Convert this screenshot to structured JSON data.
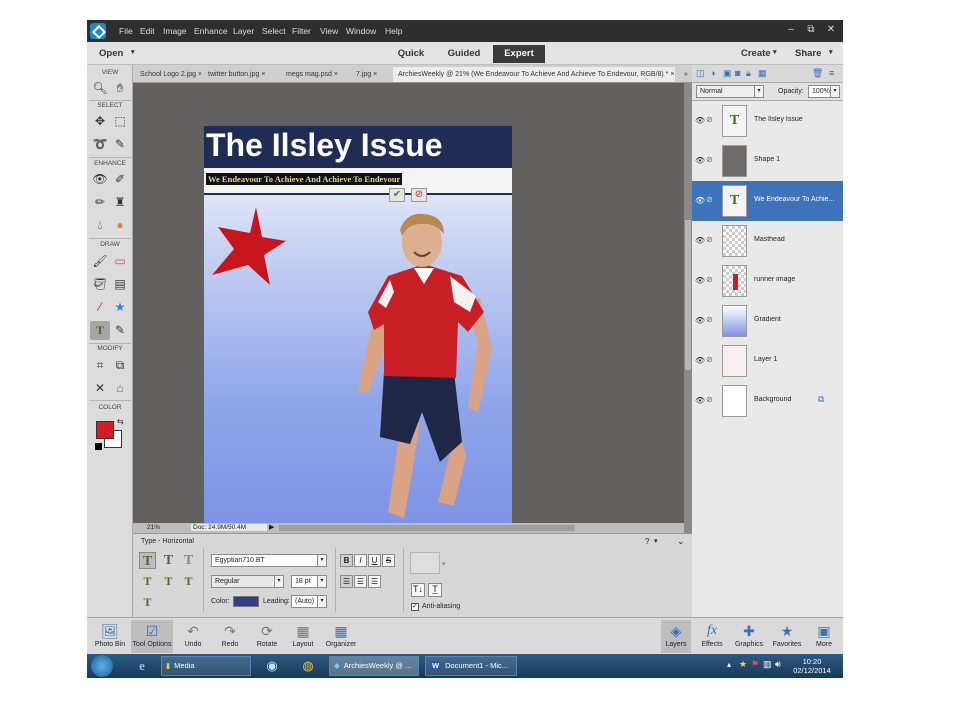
{
  "menu": [
    "File",
    "Edit",
    "Image",
    "Enhance",
    "Layer",
    "Select",
    "Filter",
    "View",
    "Window",
    "Help"
  ],
  "window_controls": [
    "–",
    "⧉",
    "✕"
  ],
  "modebar": {
    "open_label": "Open",
    "modes": [
      "Quick",
      "Guided",
      "Expert"
    ],
    "active_mode": "Expert",
    "create_label": "Create",
    "share_label": "Share"
  },
  "toolbar": {
    "sections": [
      "VIEW",
      "SELECT",
      "ENHANCE",
      "DRAW",
      "MODIFY",
      "COLOR"
    ],
    "tools": [
      {
        "name": "zoom-tool-icon",
        "glyph": "🔍︎"
      },
      {
        "name": "hand-tool-icon",
        "glyph": "✋︎"
      },
      {
        "name": "move-tool-icon",
        "glyph": "✥"
      },
      {
        "name": "marquee-tool-icon",
        "glyph": "⬚"
      },
      {
        "name": "lasso-tool-icon",
        "glyph": "➰"
      },
      {
        "name": "quick-select-tool-icon",
        "glyph": "✎"
      },
      {
        "name": "red-eye-tool-icon",
        "glyph": "👁︎"
      },
      {
        "name": "spot-healing-tool-icon",
        "glyph": "✐"
      },
      {
        "name": "smart-brush-tool-icon",
        "glyph": "✏︎"
      },
      {
        "name": "clone-stamp-tool-icon",
        "glyph": "♜"
      },
      {
        "name": "blur-tool-icon",
        "glyph": "💧︎"
      },
      {
        "name": "sponge-tool-icon",
        "glyph": "●"
      },
      {
        "name": "brush-tool-icon",
        "glyph": "🖌︎"
      },
      {
        "name": "eraser-tool-icon",
        "glyph": "▭"
      },
      {
        "name": "paint-bucket-tool-icon",
        "glyph": "🪣︎"
      },
      {
        "name": "gradient-tool-icon",
        "glyph": "▤"
      },
      {
        "name": "eyedropper-tool-icon",
        "glyph": "⁄"
      },
      {
        "name": "custom-shape-tool-icon",
        "glyph": "★"
      },
      {
        "name": "type-tool-icon",
        "glyph": "T"
      },
      {
        "name": "pencil-tool-icon",
        "glyph": "✎"
      },
      {
        "name": "crop-tool-icon",
        "glyph": "⌗"
      },
      {
        "name": "recompose-tool-icon",
        "glyph": "⧉"
      },
      {
        "name": "content-move-tool-icon",
        "glyph": "✕"
      },
      {
        "name": "straighten-tool-icon",
        "glyph": "⌂"
      }
    ],
    "foreground_color": "#d21e24",
    "background_color": "#ffffff"
  },
  "doc_tabs": [
    {
      "label": "School Logo 2.jpg",
      "close": "×"
    },
    {
      "label": "twitter button.jpg",
      "close": "×"
    },
    {
      "label": "megs mag.psd",
      "close": "×"
    },
    {
      "label": "7.jpg",
      "close": "×"
    },
    {
      "label": "ArchiesWeekly @ 21% (We Endeavour To Achieve And Achieve To Endevour, RGB/8) *",
      "close": "×"
    }
  ],
  "overflow_label": "»",
  "document": {
    "title": "The Ilsley Issue",
    "subtitle": "We Endeavour To Achieve And Achieve To Endevour",
    "commit_glyph": "✔",
    "cancel_glyph": "⊘",
    "masthead_color": "#1f2c54",
    "star_color": "#c8151d"
  },
  "status": {
    "zoom": "21%",
    "doc_info": "Doc: 24.9M/50.4M"
  },
  "tool_options": {
    "tool_name": "Type - Horizontal",
    "font_family": "Egyptian710 BT",
    "font_style": "Regular",
    "font_size": "18 pt",
    "color_label": "Color:",
    "color_value": "#333d8a",
    "leading_label": "Leading:",
    "leading_value": "(Auto)",
    "bold": "B",
    "italic": "I",
    "underline": "U",
    "strike": "S",
    "anti_aliasing_label": "Anti-aliasing",
    "anti_aliasing_checked": true,
    "help_glyph": "?"
  },
  "layers": {
    "blend_mode": "Normal",
    "opacity_label": "Opacity:",
    "opacity_value": "100%",
    "items": [
      {
        "name": "The Ilsley Issue",
        "type": "text",
        "selected": false
      },
      {
        "name": "Shape 1",
        "type": "shape",
        "selected": false
      },
      {
        "name": "We Endeavour To Achie...",
        "type": "text",
        "selected": true
      },
      {
        "name": "Masthead",
        "type": "transparent",
        "selected": false
      },
      {
        "name": "runner image",
        "type": "image",
        "selected": false
      },
      {
        "name": "Gradient",
        "type": "gradient",
        "selected": false
      },
      {
        "name": "Layer 1",
        "type": "fill",
        "selected": false
      },
      {
        "name": "Background",
        "type": "background",
        "selected": false
      }
    ]
  },
  "bottom_panel": {
    "left": [
      {
        "label": "Photo Bin",
        "icon": "photo-bin-icon",
        "glyph": "🖼︎"
      },
      {
        "label": "Tool Options",
        "icon": "tool-options-icon",
        "glyph": "☑"
      },
      {
        "label": "Undo",
        "icon": "undo-icon",
        "glyph": "↶"
      },
      {
        "label": "Redo",
        "icon": "redo-icon",
        "glyph": "↷"
      },
      {
        "label": "Rotate",
        "icon": "rotate-icon",
        "glyph": "⟳"
      },
      {
        "label": "Layout",
        "icon": "layout-icon",
        "glyph": "▦"
      },
      {
        "label": "Organizer",
        "icon": "organizer-icon",
        "glyph": "▦"
      }
    ],
    "right": [
      {
        "label": "Layers",
        "icon": "layers-icon",
        "glyph": "◈"
      },
      {
        "label": "Effects",
        "icon": "effects-icon",
        "glyph": "fx"
      },
      {
        "label": "Graphics",
        "icon": "graphics-icon",
        "glyph": "✚"
      },
      {
        "label": "Favorites",
        "icon": "favorites-icon",
        "glyph": "★"
      },
      {
        "label": "More",
        "icon": "more-icon",
        "glyph": "▣"
      }
    ]
  },
  "taskbar": {
    "apps": [
      {
        "label": "Media",
        "icon": "folder-icon"
      },
      {
        "label": "ArchiesWeekly @ ...",
        "icon": "photoshop-elements-icon"
      },
      {
        "label": "Document1 - Mic...",
        "icon": "word-icon"
      }
    ],
    "time": "10:20",
    "date": "02/12/2014"
  }
}
